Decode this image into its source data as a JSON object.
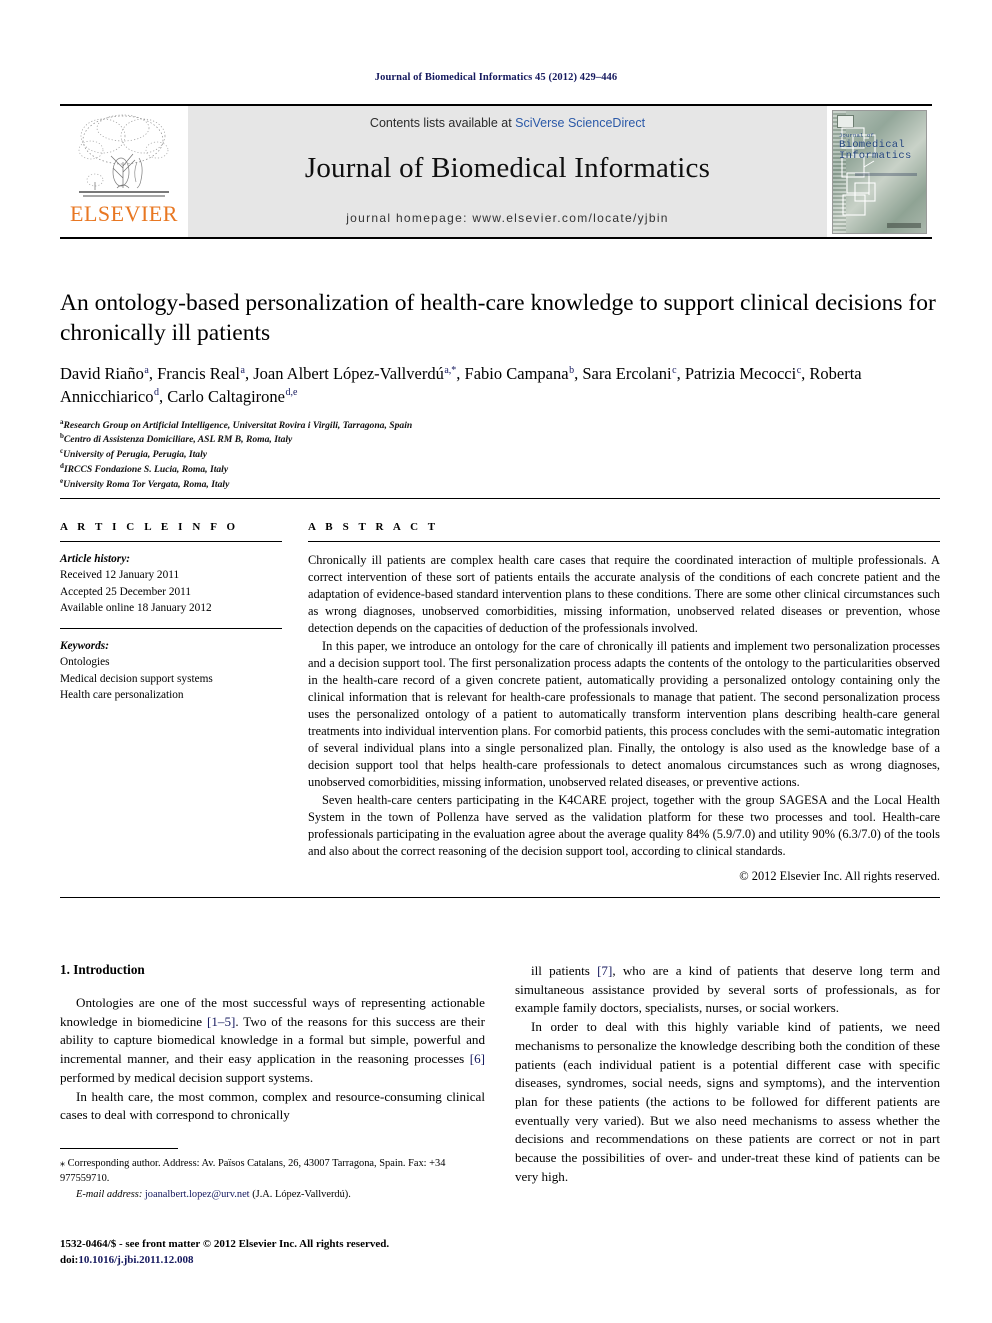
{
  "running_head": "Journal of Biomedical Informatics 45 (2012) 429–446",
  "masthead": {
    "publisher_logo_text": "ELSEVIER",
    "contents_prefix": "Contents lists available at ",
    "contents_link": "SciVerse ScienceDirect",
    "journal_title": "Journal of Biomedical Informatics",
    "homepage_line": "journal homepage: www.elsevier.com/locate/yjbin",
    "cover": {
      "sup_line": "Journal of",
      "line1": "Biomedical",
      "line2": "Informatics"
    }
  },
  "article": {
    "title": "An ontology-based personalization of health-care knowledge to support clinical decisions for chronically ill patients",
    "authors": [
      {
        "name": "David Riaño",
        "sup": "a",
        "sep": ", "
      },
      {
        "name": "Francis Real",
        "sup": "a",
        "sep": ", "
      },
      {
        "name": "Joan Albert López-Vallverdú",
        "sup": "a,*",
        "sep": ", "
      },
      {
        "name": "Fabio Campana",
        "sup": "b",
        "sep": ", "
      },
      {
        "name": "Sara Ercolani",
        "sup": "c",
        "sep": ", "
      },
      {
        "name": "Patrizia Mecocci",
        "sup": "c",
        "sep": ", "
      },
      {
        "name": "Roberta Annicchiarico",
        "sup": "d",
        "sep": ", "
      },
      {
        "name": "Carlo Caltagirone",
        "sup": "d,e",
        "sep": ""
      }
    ],
    "affiliations": [
      {
        "sup": "a",
        "text": "Research Group on Artificial Intelligence, Universitat Rovira i Virgili, Tarragona, Spain"
      },
      {
        "sup": "b",
        "text": "Centro di Assistenza Domiciliare, ASL RM B, Roma, Italy"
      },
      {
        "sup": "c",
        "text": "University of Perugia, Perugia, Italy"
      },
      {
        "sup": "d",
        "text": "IRCCS Fondazione S. Lucia, Roma, Italy"
      },
      {
        "sup": "e",
        "text": "University Roma Tor Vergata, Roma, Italy"
      }
    ]
  },
  "article_info": {
    "heading": "A R T I C L E    I N F O",
    "history_label": "Article history:",
    "history": [
      "Received 12 January 2011",
      "Accepted 25 December 2011",
      "Available online 18 January 2012"
    ],
    "keywords_label": "Keywords:",
    "keywords": [
      "Ontologies",
      "Medical decision support systems",
      "Health care personalization"
    ]
  },
  "abstract": {
    "heading": "A B S T R A C T",
    "paragraphs": [
      "Chronically ill patients are complex health care cases that require the coordinated interaction of multiple professionals. A correct intervention of these sort of patients entails the accurate analysis of the conditions of each concrete patient and the adaptation of evidence-based standard intervention plans to these conditions. There are some other clinical circumstances such as wrong diagnoses, unobserved comorbidities, missing information, unobserved related diseases or prevention, whose detection depends on the capacities of deduction of the professionals involved.",
      "In this paper, we introduce an ontology for the care of chronically ill patients and implement two personalization processes and a decision support tool. The first personalization process adapts the contents of the ontology to the particularities observed in the health-care record of a given concrete patient, automatically providing a personalized ontology containing only the clinical information that is relevant for health-care professionals to manage that patient. The second personalization process uses the personalized ontology of a patient to automatically transform intervention plans describing health-care general treatments into individual intervention plans. For comorbid patients, this process concludes with the semi-automatic integration of several individual plans into a single personalized plan. Finally, the ontology is also used as the knowledge base of a decision support tool that helps health-care professionals to detect anomalous circumstances such as wrong diagnoses, unobserved comorbidities, missing information, unobserved related diseases, or preventive actions.",
      "Seven health-care centers participating in the K4CARE project, together with the group SAGESA and the Local Health System in the town of Pollenza have served as the validation platform for these two processes and tool. Health-care professionals participating in the evaluation agree about the average quality 84% (5.9/7.0) and utility 90% (6.3/7.0) of the tools and also about the correct reasoning of the decision support tool, according to clinical standards."
    ],
    "copyright": "© 2012 Elsevier Inc. All rights reserved."
  },
  "body": {
    "section_number_title": "1. Introduction",
    "left_paragraphs": [
      {
        "parts": [
          {
            "t": "Ontologies are one of the most successful ways of representing actionable knowledge in biomedicine "
          },
          {
            "t": "[1–5]",
            "ref": true
          },
          {
            "t": ". Two of the reasons for this success are their ability to capture biomedical knowledge in a formal but simple, powerful and incremental manner, and their easy application in the reasoning processes "
          },
          {
            "t": "[6]",
            "ref": true
          },
          {
            "t": " performed by medical decision support systems."
          }
        ]
      },
      {
        "parts": [
          {
            "t": "In health care, the most common, complex and resource-consuming clinical cases to deal with correspond to chronically"
          }
        ]
      }
    ],
    "right_paragraphs": [
      {
        "parts": [
          {
            "t": "ill patients "
          },
          {
            "t": "[7]",
            "ref": true
          },
          {
            "t": ", who are a kind of patients that deserve long term and simultaneous assistance provided by several sorts of professionals, as for example family doctors, specialists, nurses, or social workers."
          }
        ]
      },
      {
        "parts": [
          {
            "t": "In order to deal with this highly variable kind of patients, we need mechanisms to personalize the knowledge describing both the condition of these patients (each individual patient is a potential different case with specific diseases, syndromes, social needs, signs and symptoms), and the intervention plan for these patients (the actions to be followed for different patients are eventually very varied). But we also need mechanisms to assess whether the decisions and recommendations on these patients are correct or not in part because the possibilities of over- and under-treat these kind of patients can be very high."
          }
        ]
      }
    ]
  },
  "footnotes": {
    "corresponding": "Corresponding author. Address: Av. Països Catalans, 26, 43007 Tarragona, Spain. Fax: +34 977559710.",
    "email_label": "E-mail address:",
    "email": "joanalbert.lopez@urv.net",
    "email_owner": "(J.A. López-Vallverdú)."
  },
  "imprint": {
    "line1": "1532-0464/$ - see front matter © 2012 Elsevier Inc. All rights reserved.",
    "doi_prefix": "doi:",
    "doi": "10.1016/j.jbi.2011.12.008"
  }
}
